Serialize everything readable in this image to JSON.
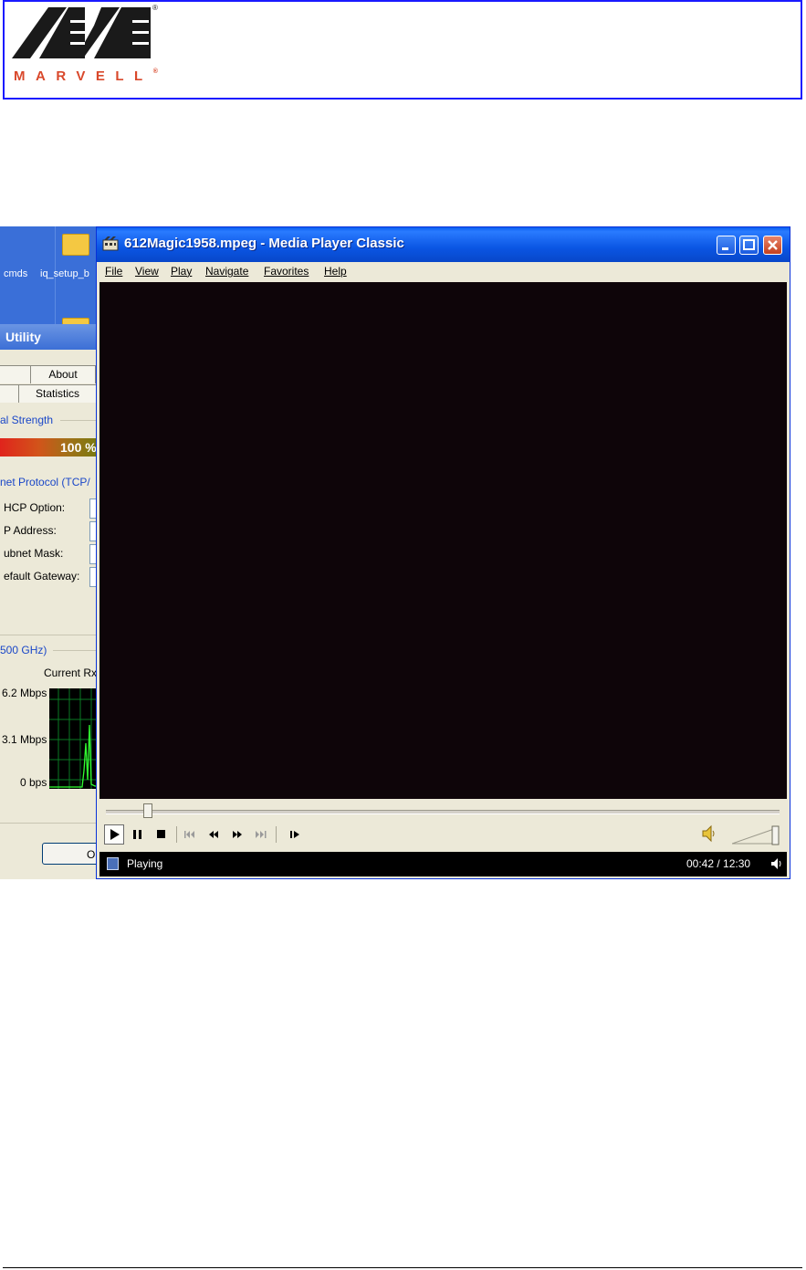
{
  "header": {
    "logo_text": "MARVELL",
    "registered": "®"
  },
  "desktop": {
    "icons": [
      {
        "label": "cmds",
        "icon": "folder-icon"
      },
      {
        "label": "iq_setup_b",
        "icon": "folder-icon"
      }
    ]
  },
  "utility": {
    "title": "Utility",
    "tabs": [
      "About",
      "Statistics"
    ],
    "signal_group": "al Strength",
    "signal_value": "100 %",
    "signal_level": 1.0,
    "protocol_group": "net Protocol (TCP/",
    "fields": [
      "HCP Option:",
      "P Address:",
      "ubnet Mask:",
      "efault Gateway:"
    ],
    "rate_group": "500 GHz)",
    "rate_header": "Current Rx",
    "graph_labels": [
      "6.2 Mbps",
      "3.1 Mbps",
      "0 bps"
    ],
    "button_label": "O"
  },
  "mpc": {
    "title": "612Magic1958.mpeg - Media Player Classic",
    "menu": [
      "File",
      "View",
      "Play",
      "Navigate",
      "Favorites",
      "Help"
    ],
    "controls": [
      "play",
      "pause",
      "stop",
      "prev",
      "rewind",
      "fast-forward",
      "next",
      "frame-step"
    ],
    "seek_position": 0.056,
    "volume_level": 1.0,
    "status": "Playing",
    "time": "00:42 / 12:30",
    "colors": {
      "titlebar": "#0a55e3",
      "video": "#0e0509",
      "accent": "#d9482b"
    }
  }
}
